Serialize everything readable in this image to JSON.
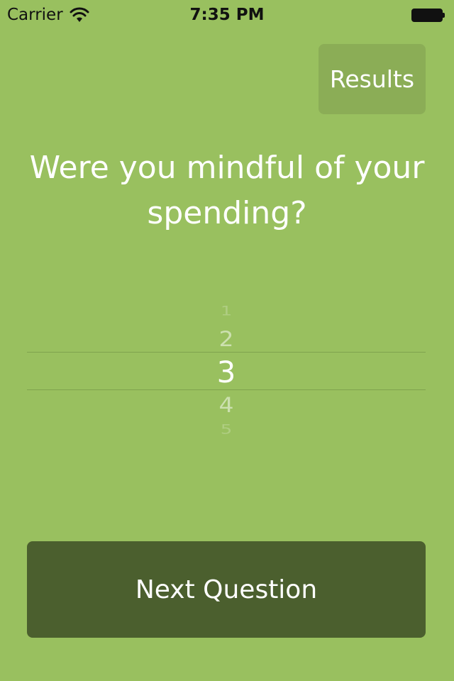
{
  "status_bar": {
    "carrier": "Carrier",
    "time": "7:35 PM",
    "icons": [
      "wifi-icon",
      "battery-icon"
    ]
  },
  "header": {
    "results_label": "Results"
  },
  "question": {
    "text": "Were you mindful of your spending?"
  },
  "picker": {
    "options": [
      "1",
      "2",
      "3",
      "4",
      "5"
    ],
    "selected": "3"
  },
  "footer": {
    "next_label": "Next Question"
  },
  "colors": {
    "background": "#99c05f",
    "results_button": "#8bad56",
    "next_button": "#4b5f2e",
    "text": "#ffffff"
  }
}
